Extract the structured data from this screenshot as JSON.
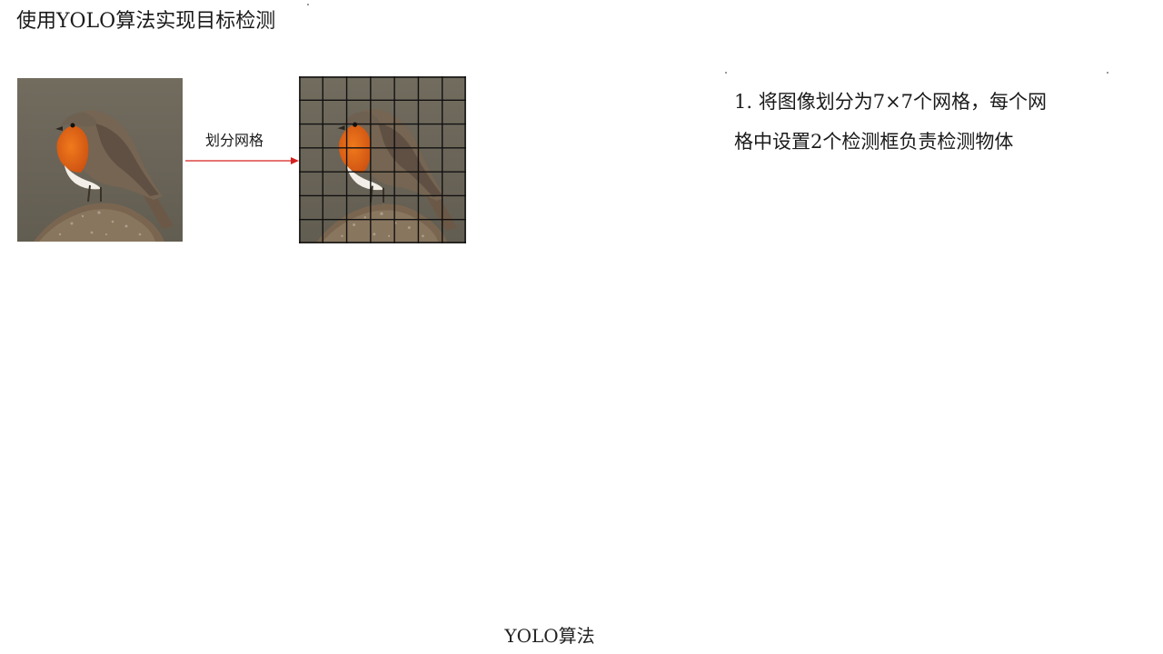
{
  "slide": {
    "title": "使用YOLO算法实现目标检测",
    "footer": "YOLO算法"
  },
  "diagram": {
    "arrow_label": "划分网格",
    "grid_size": 7,
    "arrow_color": "#d62020",
    "grid_line_color": "#111111"
  },
  "description": {
    "line1": "1. 将图像划分为7×7个网格，每个网",
    "line2": "格中设置2个检测框负责检测物体"
  }
}
